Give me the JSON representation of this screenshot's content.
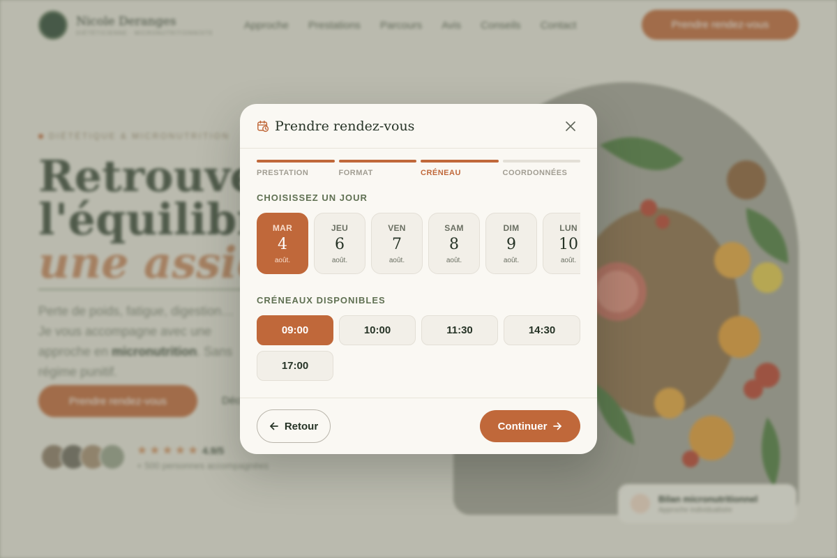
{
  "background": {
    "brand_name": "Nicole Deranges",
    "brand_subtitle": "DIÉTÉTICIENNE · MICRONUTRITIONNISTE",
    "nav_links": [
      "Approche",
      "Prestations",
      "Parcours",
      "Avis",
      "Conseils",
      "Contact"
    ],
    "nav_cta": "Prendre rendez-vous",
    "eyebrow": "DIÉTÉTIQUE & MICRONUTRITION",
    "headline_line1": "Retrouver",
    "headline_line2": "l'équilibre,",
    "headline_accent": "une assiette",
    "intro_text": "Perte de poids, fatigue, digestion… Je vous accompagne avec une approche en",
    "intro_bold": "micronutrition",
    "intro_tail": ". Sans régime punitif.",
    "hero_cta": "Prendre rendez-vous",
    "secondary_link": "Découvrir",
    "stars": "★★★★★",
    "rating": "4.9/5",
    "reviews": "+ 500 personnes accompagnées",
    "badge_title": "Bilan micronutritionnel",
    "badge_subtitle": "Approche individualisée"
  },
  "modal": {
    "title": "Prendre rendez-vous",
    "steps": [
      {
        "label": "PRESTATION",
        "state": "done"
      },
      {
        "label": "FORMAT",
        "state": "done"
      },
      {
        "label": "CRÉNEAU",
        "state": "active"
      },
      {
        "label": "COORDONNÉES",
        "state": "pending"
      }
    ],
    "days_title": "CHOISISSEZ UN JOUR",
    "days": [
      {
        "dow": "MAR",
        "num": "4",
        "month": "août.",
        "selected": true
      },
      {
        "dow": "JEU",
        "num": "6",
        "month": "août.",
        "selected": false
      },
      {
        "dow": "VEN",
        "num": "7",
        "month": "août.",
        "selected": false
      },
      {
        "dow": "SAM",
        "num": "8",
        "month": "août.",
        "selected": false
      },
      {
        "dow": "DIM",
        "num": "9",
        "month": "août.",
        "selected": false
      },
      {
        "dow": "LUN",
        "num": "10",
        "month": "août.",
        "selected": false
      }
    ],
    "slots_title": "CRÉNEAUX DISPONIBLES",
    "slots": [
      {
        "time": "09:00",
        "selected": true
      },
      {
        "time": "10:00",
        "selected": false
      },
      {
        "time": "11:30",
        "selected": false
      },
      {
        "time": "14:30",
        "selected": false
      },
      {
        "time": "17:00",
        "selected": false
      }
    ],
    "back_label": "Retour",
    "continue_label": "Continuer"
  },
  "colors": {
    "accent": "#c0683a",
    "brand_green": "#2f4a37",
    "section_title": "#5f7052",
    "modal_bg": "#faf8f3"
  },
  "icons": {
    "header": "calendar-clock-icon",
    "close": "close-icon",
    "back": "arrow-left-icon",
    "next": "arrow-right-icon"
  }
}
